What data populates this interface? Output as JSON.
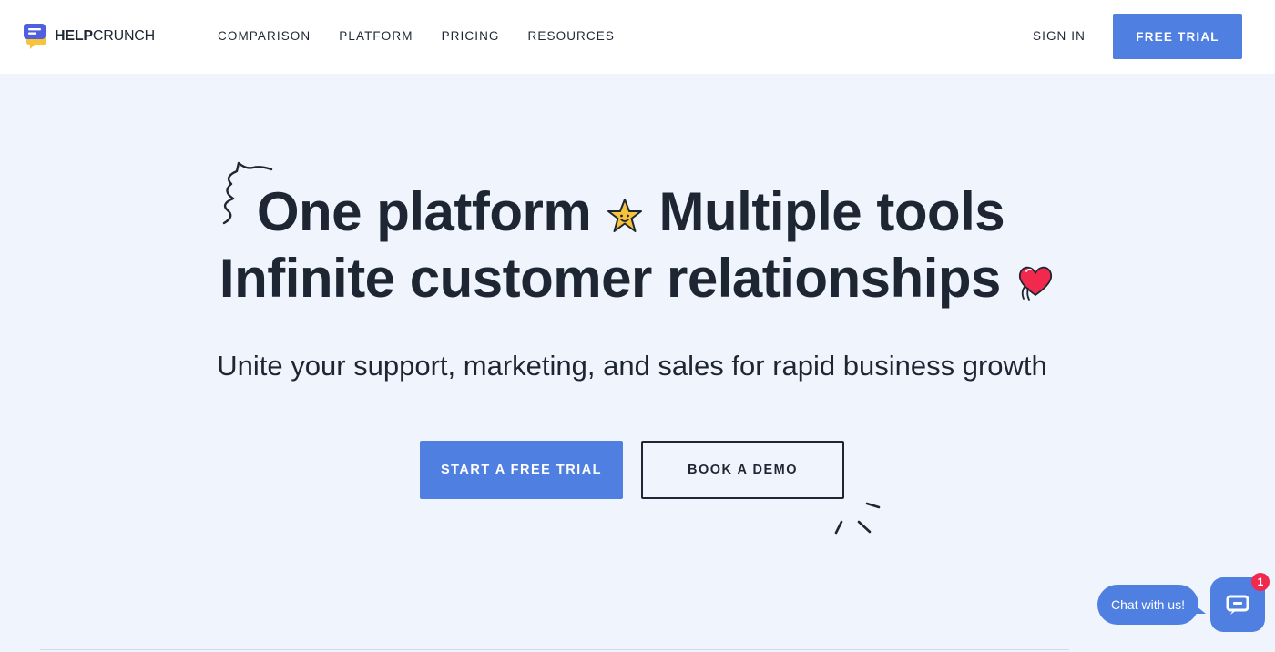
{
  "brand": {
    "name_bold": "HELP",
    "name_regular": "CRUNCH"
  },
  "nav": {
    "items": [
      {
        "label": "COMPARISON"
      },
      {
        "label": "PLATFORM"
      },
      {
        "label": "PRICING"
      },
      {
        "label": "RESOURCES"
      }
    ],
    "sign_in": "SIGN IN",
    "free_trial": "FREE TRIAL"
  },
  "hero": {
    "line1_part1": "One platform",
    "line1_part2": "Multiple tools",
    "line2": "Infinite customer relationships",
    "subtitle": "Unite your support, marketing, and sales for rapid business growth",
    "primary_cta": "START A FREE TRIAL",
    "secondary_cta": "BOOK A DEMO"
  },
  "chat_widget": {
    "bubble_text": "Chat with us!",
    "badge_count": "1"
  },
  "colors": {
    "accent": "#4f7fe0",
    "text": "#1f2633",
    "page_bg": "#f0f5fd",
    "badge": "#f0294d"
  },
  "icons": [
    "helpcrunch-logo",
    "star-emoji-icon",
    "heart-hands-emoji-icon",
    "squiggle-decoration",
    "sparkle-decoration",
    "chat-icon"
  ]
}
